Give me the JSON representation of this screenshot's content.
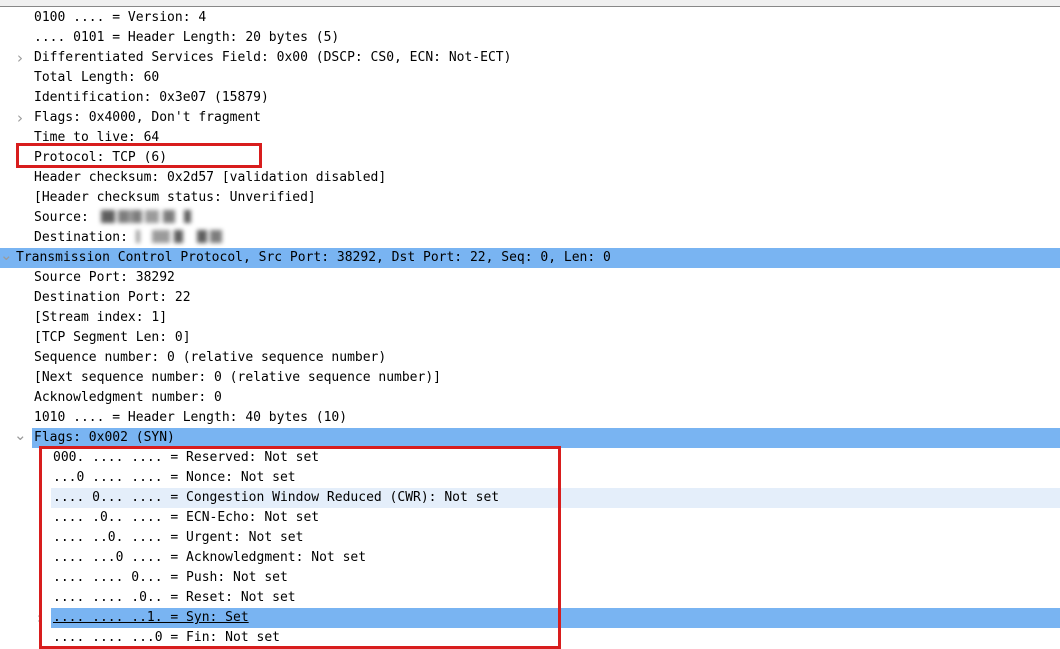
{
  "app": {
    "title": "Wireshark Packet Details",
    "panel": "packet-detail-tree"
  },
  "colors": {
    "selection_blue": "#79b4f2",
    "hover_blue": "#e4eefa",
    "annotation_red": "#d81d1d",
    "chevron_gray": "#9a9a9a",
    "text": "#000000",
    "background": "#ffffff"
  },
  "annotations": [
    {
      "name": "protocol-highlight-box",
      "target": "Protocol: TCP (6)",
      "color": "#d81d1d"
    },
    {
      "name": "tcp-flags-highlight-box",
      "target": "TCP Flags bit fields",
      "color": "#d81d1d"
    }
  ],
  "tree": {
    "ipv4_rows": [
      {
        "label": "0100 .... = Version: 4",
        "indent": 1,
        "chevron": "none",
        "state": "normal"
      },
      {
        "label": ".... 0101 = Header Length: 20 bytes (5)",
        "indent": 1,
        "chevron": "none",
        "state": "normal"
      },
      {
        "label": "Differentiated Services Field: 0x00 (DSCP: CS0, ECN: Not-ECT)",
        "indent": 1,
        "chevron": "closed",
        "state": "normal"
      },
      {
        "label": "Total Length: 60",
        "indent": 1,
        "chevron": "none",
        "state": "normal"
      },
      {
        "label": "Identification: 0x3e07 (15879)",
        "indent": 1,
        "chevron": "none",
        "state": "normal"
      },
      {
        "label": "Flags: 0x4000, Don't fragment",
        "indent": 1,
        "chevron": "closed",
        "state": "normal"
      },
      {
        "label": "Time to live: 64",
        "indent": 1,
        "chevron": "none",
        "state": "normal"
      },
      {
        "label": "Protocol: TCP (6)",
        "indent": 1,
        "chevron": "none",
        "state": "boxed"
      },
      {
        "label": "Header checksum: 0x2d57 [validation disabled]",
        "indent": 1,
        "chevron": "none",
        "state": "normal"
      },
      {
        "label": "[Header checksum status: Unverified]",
        "indent": 1,
        "chevron": "none",
        "state": "normal"
      },
      {
        "label": "Source:",
        "indent": 1,
        "chevron": "none",
        "state": "redacted",
        "redacted_value": "<redacted IPv4 address>"
      },
      {
        "label": "Destination:",
        "indent": 1,
        "chevron": "none",
        "state": "redacted",
        "redacted_value": "<redacted IPv4 address>"
      }
    ],
    "tcp_header": {
      "label": "Transmission Control Protocol, Src Port: 38292, Dst Port: 22, Seq: 0, Len: 0",
      "chevron": "open",
      "state": "selected"
    },
    "tcp_rows": [
      {
        "label": "Source Port: 38292",
        "indent": 1,
        "chevron": "none",
        "state": "normal"
      },
      {
        "label": "Destination Port: 22",
        "indent": 1,
        "chevron": "none",
        "state": "normal"
      },
      {
        "label": "[Stream index: 1]",
        "indent": 1,
        "chevron": "none",
        "state": "normal"
      },
      {
        "label": "[TCP Segment Len: 0]",
        "indent": 1,
        "chevron": "none",
        "state": "normal"
      },
      {
        "label": "Sequence number: 0    (relative sequence number)",
        "indent": 1,
        "chevron": "none",
        "state": "normal"
      },
      {
        "label": "[Next sequence number: 0    (relative sequence number)]",
        "indent": 1,
        "chevron": "none",
        "state": "normal"
      },
      {
        "label": "Acknowledgment number: 0",
        "indent": 1,
        "chevron": "none",
        "state": "normal"
      },
      {
        "label": "1010 .... = Header Length: 40 bytes (10)",
        "indent": 1,
        "chevron": "none",
        "state": "normal"
      }
    ],
    "tcp_flags_header": {
      "label": "Flags: 0x002 (SYN)",
      "chevron": "open",
      "state": "selected"
    },
    "tcp_flag_rows": [
      {
        "bits": "000. .... ....",
        "name": "Reserved",
        "value": "Not set",
        "label": "000. .... .... = Reserved: Not set",
        "state": "normal",
        "chevron": "none"
      },
      {
        "bits": "...0 .... ....",
        "name": "Nonce",
        "value": "Not set",
        "label": "...0 .... .... = Nonce: Not set",
        "state": "normal",
        "chevron": "none"
      },
      {
        "bits": ".... 0... ....",
        "name": "Congestion Window Reduced (CWR)",
        "value": "Not set",
        "label": ".... 0... .... = Congestion Window Reduced (CWR): Not set",
        "state": "hover",
        "chevron": "none"
      },
      {
        "bits": ".... .0.. ....",
        "name": "ECN-Echo",
        "value": "Not set",
        "label": ".... .0.. .... = ECN-Echo: Not set",
        "state": "normal",
        "chevron": "none"
      },
      {
        "bits": ".... ..0. ....",
        "name": "Urgent",
        "value": "Not set",
        "label": ".... ..0. .... = Urgent: Not set",
        "state": "normal",
        "chevron": "none"
      },
      {
        "bits": ".... ...0 ....",
        "name": "Acknowledgment",
        "value": "Not set",
        "label": ".... ...0 .... = Acknowledgment: Not set",
        "state": "normal",
        "chevron": "none"
      },
      {
        "bits": ".... .... 0...",
        "name": "Push",
        "value": "Not set",
        "label": ".... .... 0... = Push: Not set",
        "state": "normal",
        "chevron": "none"
      },
      {
        "bits": ".... .... .0..",
        "name": "Reset",
        "value": "Not set",
        "label": ".... .... .0.. = Reset: Not set",
        "state": "normal",
        "chevron": "none"
      },
      {
        "bits": ".... .... ..1.",
        "name": "Syn",
        "value": "Set",
        "label": ".... .... ..1. = Syn: Set",
        "state": "selected",
        "chevron": "closed"
      },
      {
        "bits": ".... .... ...0",
        "name": "Fin",
        "value": "Not set",
        "label": ".... .... ...0 = Fin: Not set",
        "state": "normal",
        "chevron": "none"
      }
    ]
  }
}
